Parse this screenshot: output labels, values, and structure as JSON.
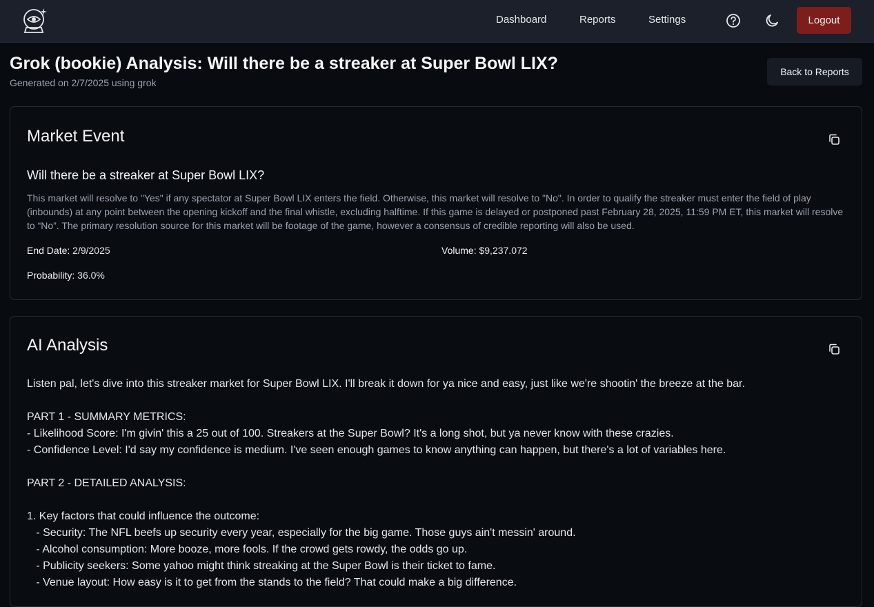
{
  "nav": {
    "links": [
      "Dashboard",
      "Reports",
      "Settings"
    ],
    "logout_label": "Logout",
    "icons": [
      "crystal-ball-icon",
      "help-circle-icon",
      "moon-icon"
    ]
  },
  "header": {
    "title": "Grok (bookie) Analysis: Will there be a streaker at Super Bowl LIX?",
    "subtitle": "Generated on 2/7/2025 using grok",
    "back_label": "Back to Reports"
  },
  "market": {
    "heading": "Market Event",
    "question": "Will there be a streaker at Super Bowl LIX?",
    "description": "This market will resolve to \"Yes\" if any spectator at Super Bowl LIX enters the field. Otherwise, this market will resolve to \"No\". In order to qualify the streaker must enter the field of play (inbounds) at any point between the opening kickoff and the final whistle, excluding halftime. If this game is delayed or postponed past February 28, 2025, 11:59 PM ET, this market will resolve to “No”. The primary resolution source for this market will be footage of the game, however a consensus of credible reporting will also be used.",
    "end_date_label": "End Date:",
    "end_date": "2/9/2025",
    "volume_label": "Volume:",
    "volume": "$9,237.072",
    "probability_label": "Probability:",
    "probability": "36.0%"
  },
  "analysis": {
    "heading": "AI Analysis",
    "lines": [
      "Listen pal, let's dive into this streaker market for Super Bowl LIX. I'll break it down for ya nice and easy, just like we're shootin' the breeze at the bar.",
      "",
      "PART 1 - SUMMARY METRICS:",
      "- Likelihood Score: I'm givin' this a 25 out of 100. Streakers at the Super Bowl? It's a long shot, but ya never know with these crazies.",
      "- Confidence Level: I'd say my confidence is medium. I've seen enough games to know anything can happen, but there's a lot of variables here.",
      "",
      "PART 2 - DETAILED ANALYSIS:",
      "",
      "1. Key factors that could influence the outcome:",
      "   - Security: The NFL beefs up security every year, especially for the big game. Those guys ain't messin' around.",
      "   - Alcohol consumption: More booze, more fools. If the crowd gets rowdy, the odds go up.",
      "   - Publicity seekers: Some yahoo might think streaking at the Super Bowl is their ticket to fame.",
      "   - Venue layout: How easy is it to get from the stands to the field? That could make a big difference."
    ]
  },
  "colors": {
    "background": "#080b10",
    "topbar": "#1b202b",
    "logout": "#7f1d1d",
    "muted_text": "#9ca3af"
  }
}
